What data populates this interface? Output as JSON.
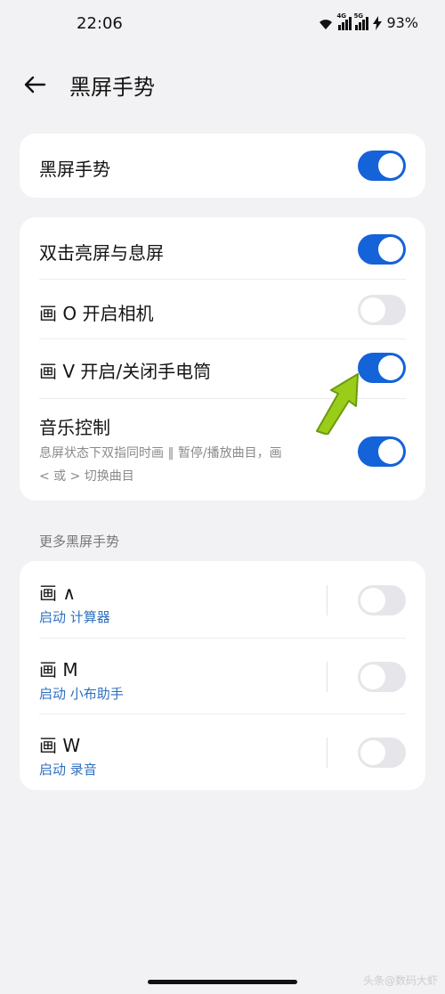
{
  "status": {
    "time": "22:06",
    "net1": "4G",
    "net2": "5G",
    "battery": "93%"
  },
  "header": {
    "title": "黑屏手势"
  },
  "main_toggle": {
    "label": "黑屏手势",
    "on": true
  },
  "gestures": [
    {
      "label": "双击亮屏与息屏",
      "on": true
    },
    {
      "label": "画 O 开启相机",
      "on": false
    },
    {
      "label": "画 V 开启/关闭手电筒",
      "on": true
    },
    {
      "label": "音乐控制",
      "desc_line1": "息屏状态下双指同时画 ‖ 暂停/播放曲目，画",
      "desc_line2": "< 或 > 切换曲目",
      "on": true
    }
  ],
  "more": {
    "section_label": "更多黑屏手势",
    "items": [
      {
        "label": "画 ∧",
        "action": "启动 计算器",
        "on": false
      },
      {
        "label": "画 M",
        "action": "启动 小布助手",
        "on": false
      },
      {
        "label": "画 W",
        "action": "启动 录音",
        "on": false
      }
    ]
  },
  "watermark": "头条@数码大虾",
  "colors": {
    "accent": "#1463d9",
    "link": "#2f6fbf",
    "background": "#f2f2f4",
    "arrow": "#9acd1a"
  }
}
